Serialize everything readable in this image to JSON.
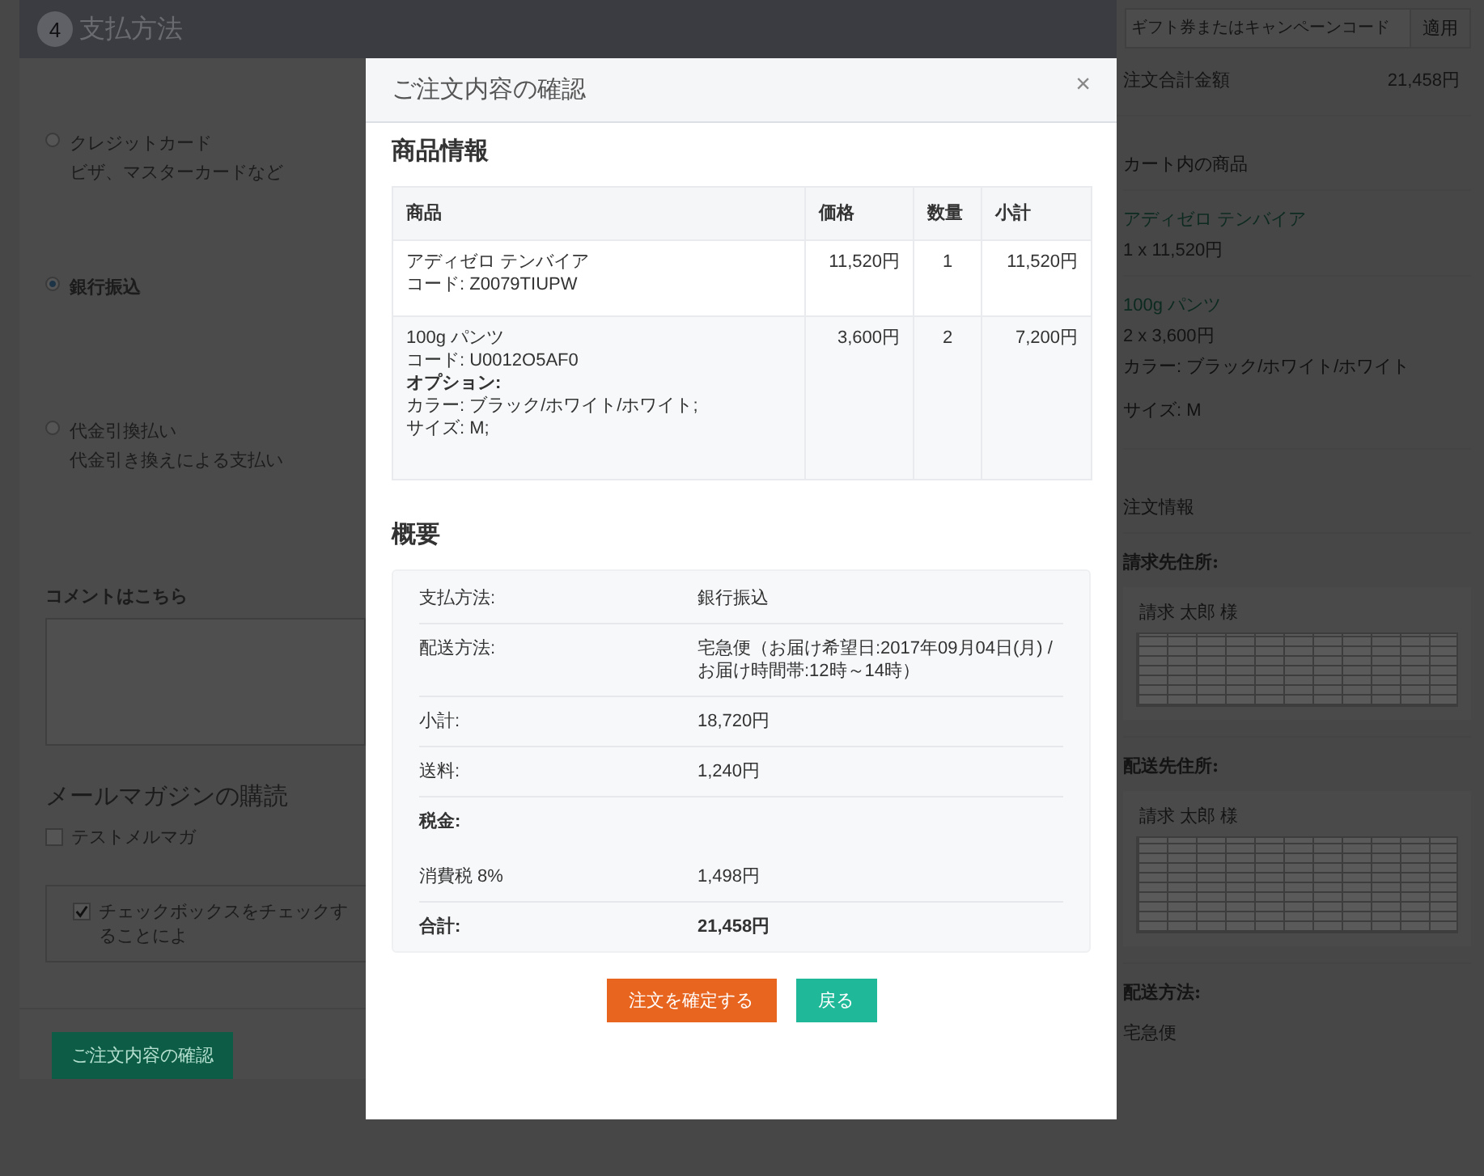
{
  "checkout": {
    "step_number": "4",
    "step_title": "支払方法",
    "payment_options": [
      {
        "label": "クレジットカード",
        "description": "ビザ、マスターカードなど",
        "selected": false
      },
      {
        "label": "銀行振込",
        "selected": true
      },
      {
        "label": "代金引換払い",
        "description": "代金引き換えによる支払い",
        "selected": false
      }
    ],
    "comment": {
      "label": "コメントはこちら"
    },
    "newsletter": {
      "heading": "メールマガジンの購読",
      "options": [
        {
          "label": "テストメルマガ",
          "checked": false
        }
      ]
    },
    "agreement": {
      "label": "チェックボックスをチェックすることによ",
      "checked": true
    },
    "confirm_button": "ご注文内容の確認"
  },
  "modal": {
    "title": "ご注文内容の確認",
    "close": "×",
    "products_heading": "商品情報",
    "table": {
      "columns": [
        "商品",
        "価格",
        "数量",
        "小計"
      ],
      "rows": [
        {
          "product_name": "アディゼロ テンバイア",
          "code": "コード: Z0079TIUPW",
          "price": "11,520円",
          "quantity": "1",
          "subtotal": "11,520円"
        },
        {
          "product_name": "100g パンツ",
          "code": "コード: U0012O5AF0",
          "options_label": "オプション:",
          "options": [
            "カラー: ブラック/ホワイト/ホワイト;",
            "サイズ: M;"
          ],
          "price": "3,600円",
          "quantity": "2",
          "subtotal": "7,200円"
        }
      ]
    },
    "summary_heading": "概要",
    "summary": [
      {
        "kind": "row",
        "label": "支払方法:",
        "value": "銀行振込"
      },
      {
        "kind": "row",
        "label": "配送方法:",
        "value": "宅急便（お届け希望日:2017年09月04日(月) / お届け時間帯:12時～14時）"
      },
      {
        "kind": "row",
        "label": "小計:",
        "value": "18,720円"
      },
      {
        "kind": "row",
        "label": "送料:",
        "value": "1,240円"
      },
      {
        "kind": "heading",
        "label": "税金:"
      },
      {
        "kind": "row",
        "label": "消費税 8%",
        "value": "1,498円"
      },
      {
        "kind": "total",
        "label": "合計:",
        "value": "21,458円"
      }
    ],
    "buttons": [
      {
        "label": "注文を確定する",
        "kind": "primary"
      },
      {
        "label": "戻る",
        "kind": "secondary"
      }
    ]
  },
  "sidebar": {
    "coupon": {
      "placeholder": "ギフト券またはキャンペーンコード",
      "button": "適用"
    },
    "total_label": "注文合計金額",
    "total_value": "21,458円",
    "cart_heading": "カート内の商品",
    "cart_items": [
      {
        "name": "アディゼロ テンバイア",
        "quantity_price": "1 x 11,520円"
      },
      {
        "name": "100g パンツ",
        "quantity_price": "2 x 3,600円",
        "attributes": [
          "カラー: ブラック/ホワイト/ホワイト",
          "サイズ: M"
        ]
      }
    ],
    "order_heading": "注文情報",
    "addresses": [
      {
        "label": "請求先住所:",
        "name": "請求 太郎 様"
      },
      {
        "label": "配送先住所:",
        "name": "請求 太郎 様"
      }
    ],
    "shipping_label": "配送方法:",
    "shipping_value": "宅急便"
  }
}
